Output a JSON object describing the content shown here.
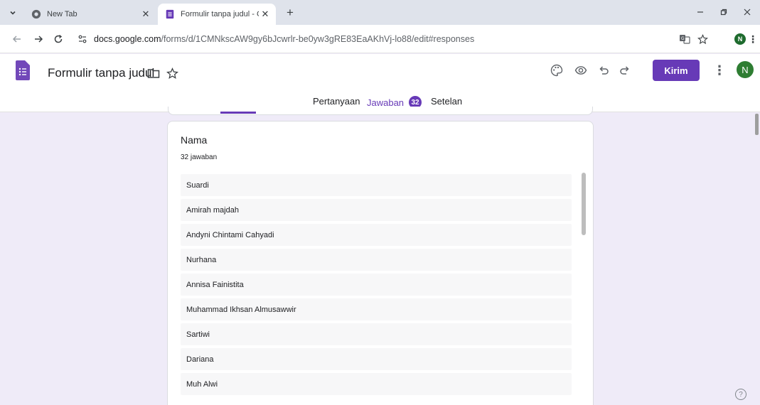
{
  "browser": {
    "tabs": [
      {
        "title": "New Tab",
        "active": false
      },
      {
        "title": "Formulir tanpa judul - Google F",
        "active": true
      }
    ],
    "new_tab_symbol": "+",
    "url_host": "docs.google.com",
    "url_path": "/forms/d/1CMNkscAW9gy6bJcwrlr-be0yw3gRE83EaAKhVj-lo88/edit#responses",
    "profile_initial": "N"
  },
  "app": {
    "title": "Formulir tanpa judul",
    "send_label": "Kirim",
    "avatar_initial": "N",
    "accent_color": "#673ab7",
    "tabs": {
      "questions": "Pertanyaan",
      "responses": "Jawaban",
      "responses_count": "32",
      "settings": "Setelan"
    }
  },
  "question": {
    "title": "Nama",
    "count_label": "32 jawaban",
    "answers": [
      "Suardi",
      "Amirah majdah",
      "Andyni Chintami Cahyadi",
      "Nurhana",
      "Annisa Fainistita",
      "Muhammad Ikhsan Almusawwir",
      "Sartiwi",
      "Dariana",
      "Muh Alwi"
    ]
  },
  "help_symbol": "?"
}
